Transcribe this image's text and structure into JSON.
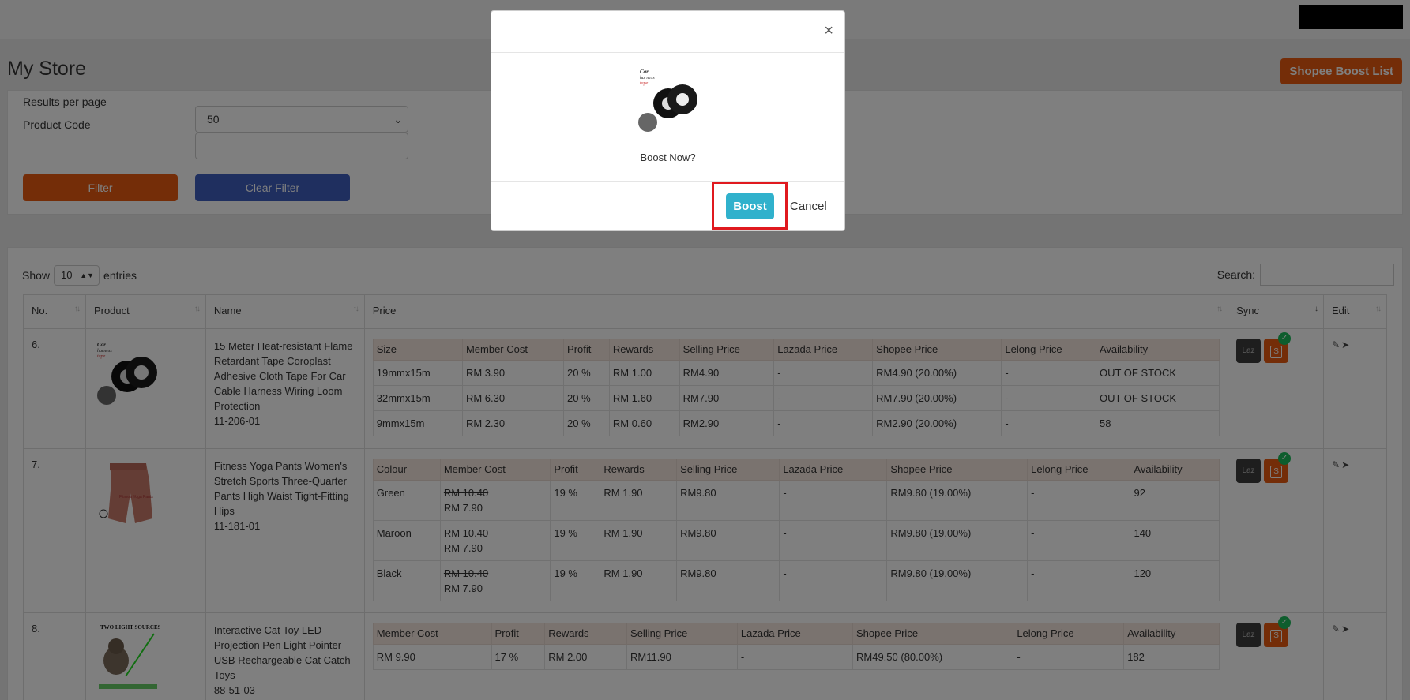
{
  "header": {
    "title": "My Store",
    "boost_list_label": "Shopee Boost List"
  },
  "filter": {
    "results_per_page_label": "Results per page",
    "results_per_page_value": "50",
    "product_code_label": "Product Code",
    "product_code_value": "",
    "filter_label": "Filter",
    "clear_filter_label": "Clear Filter"
  },
  "table_controls": {
    "show_label": "Show",
    "show_value": "10",
    "entries_label": "entries",
    "search_label": "Search:"
  },
  "columns": [
    "No.",
    "Product",
    "Name",
    "Price",
    "Sync",
    "Edit"
  ],
  "rows": [
    {
      "no": "6.",
      "name": "15 Meter Heat-resistant Flame Retardant Tape Coroplast Adhesive Cloth Tape For Car Cable Harness Wiring Loom Protection",
      "code": "11-206-01",
      "variant_headers": [
        "Size",
        "Member Cost",
        "Profit",
        "Rewards",
        "Selling Price",
        "Lazada Price",
        "Shopee Price",
        "Lelong Price",
        "Availability"
      ],
      "variants": [
        [
          "19mmx15m",
          "RM 3.90",
          "20 %",
          "RM 1.00",
          "RM4.90",
          "-",
          "RM4.90 (20.00%)",
          "-",
          "OUT OF STOCK"
        ],
        [
          "32mmx15m",
          "RM 6.30",
          "20 %",
          "RM 1.60",
          "RM7.90",
          "-",
          "RM7.90 (20.00%)",
          "-",
          "OUT OF STOCK"
        ],
        [
          "9mmx15m",
          "RM 2.30",
          "20 %",
          "RM 0.60",
          "RM2.90",
          "-",
          "RM2.90 (20.00%)",
          "-",
          "58"
        ]
      ]
    },
    {
      "no": "7.",
      "name": "Fitness Yoga Pants Women's Stretch Sports Three-Quarter Pants High Waist Tight-Fitting Hips",
      "code": "11-181-01",
      "variant_headers": [
        "Colour",
        "Member Cost",
        "Profit",
        "Rewards",
        "Selling Price",
        "Lazada Price",
        "Shopee Price",
        "Lelong Price",
        "Availability"
      ],
      "variants": [
        [
          "Green",
          "RM 10.40",
          "RM 7.90",
          "19 %",
          "RM 1.90",
          "RM9.80",
          "-",
          "RM9.80 (19.00%)",
          "-",
          "92"
        ],
        [
          "Maroon",
          "RM 10.40",
          "RM 7.90",
          "19 %",
          "RM 1.90",
          "RM9.80",
          "-",
          "RM9.80 (19.00%)",
          "-",
          "140"
        ],
        [
          "Black",
          "RM 10.40",
          "RM 7.90",
          "19 %",
          "RM 1.90",
          "RM9.80",
          "-",
          "RM9.80 (19.00%)",
          "-",
          "120"
        ]
      ]
    },
    {
      "no": "8.",
      "name": "Interactive Cat Toy LED Projection Pen Light Pointer USB Rechargeable Cat Catch Toys",
      "code": "88-51-03",
      "variant_headers": [
        "Member Cost",
        "Profit",
        "Rewards",
        "Selling Price",
        "Lazada Price",
        "Shopee Price",
        "Lelong Price",
        "Availability"
      ],
      "variants": [
        [
          "RM 9.90",
          "17 %",
          "RM 2.00",
          "RM11.90",
          "-",
          "RM49.50 (80.00%)",
          "-",
          "182"
        ]
      ]
    }
  ],
  "sync": {
    "lazada_label": "Laz",
    "shopee_label": "S",
    "check": "✓"
  },
  "modal": {
    "question": "Boost Now?",
    "boost_label": "Boost",
    "cancel_label": "Cancel",
    "close": "×"
  },
  "product_image_1": {
    "lines": [
      "Car",
      "harness",
      "tape"
    ]
  },
  "product_image_3": {
    "caption": "TWO LIGHT SOURCES"
  },
  "product_image_2": {
    "caption": "Fitness Yoga Pants"
  },
  "colors": {
    "accent_orange": "#e85b10",
    "accent_blue": "#3f5fbf",
    "boost_cyan": "#30b1cc",
    "highlight_red": "#e0191f"
  }
}
